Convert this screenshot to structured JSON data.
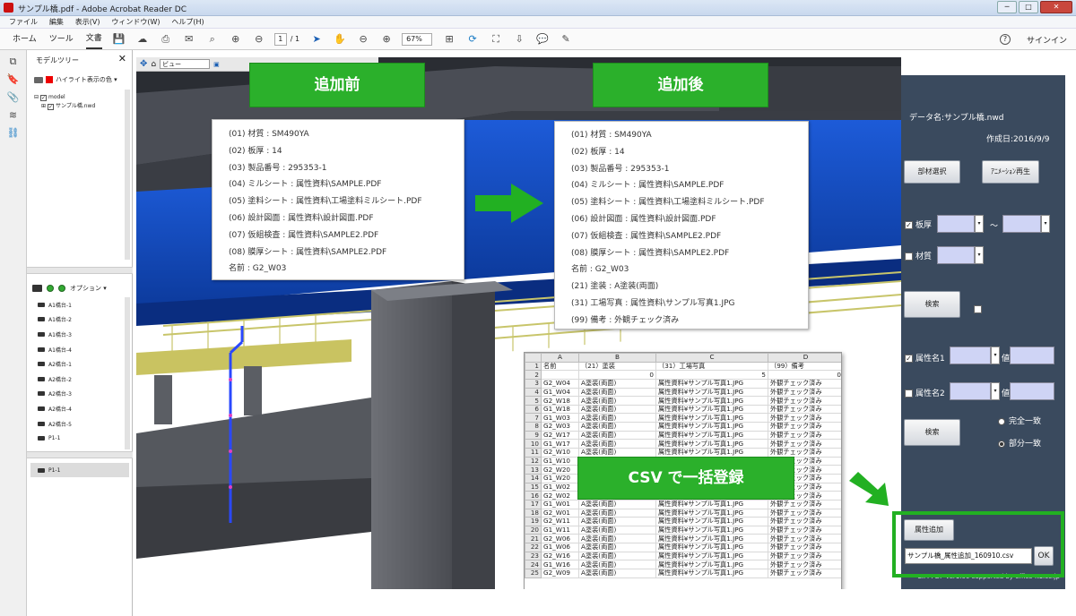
{
  "window": {
    "title": "サンプル橋.pdf - Adobe Acrobat Reader DC",
    "controls": [
      "─",
      "□",
      "✕"
    ]
  },
  "menu": [
    "ファイル",
    "編集",
    "表示(V)",
    "ウィンドウ(W)",
    "ヘルプ(H)"
  ],
  "toolbar": {
    "tabs": [
      "ホーム",
      "ツール",
      "文書"
    ],
    "active_tab": "文書",
    "page_current": "1",
    "page_total": "/ 1",
    "zoom": "67%",
    "help": "?",
    "signin": "サインイン"
  },
  "model_tree": {
    "title": "モデルツリー",
    "close": "✕",
    "highlight_label": "ハイライト表示の色 ▾",
    "highlight_color": "#e00000",
    "tree": [
      "model",
      "サンプル橋.nwd"
    ],
    "options_label": "オプション ▾",
    "items": [
      "A1橋台-1",
      "A1橋台-2",
      "A1橋台-3",
      "A1橋台-4",
      "A2橋台-1",
      "A2橋台-2",
      "A2橋台-3",
      "A2橋台-4",
      "A2橋台-5",
      "P1-1"
    ],
    "selected_item": "P1-1"
  },
  "viewer": {
    "view_select": "ビュー"
  },
  "labels": {
    "before": "追加前",
    "after": "追加後",
    "csv": "CSV で一括登録"
  },
  "before_props": [
    "(01) 材質 : SM490YA",
    "(02) 板厚 : 14",
    "(03) 製品番号 : 295353-1",
    "(04) ミルシート : 属性資料\\SAMPLE.PDF",
    "(05) 塗料シート : 属性資料\\工場塗料ミルシート.PDF",
    "(06) 設計図面 : 属性資料\\設計図面.PDF",
    "(07) 仮組検査 : 属性資料\\SAMPLE2.PDF",
    "(08) 膜厚シート : 属性資料\\SAMPLE2.PDF",
    "名前 : G2_W03"
  ],
  "after_props": [
    "(01) 材質 : SM490YA",
    "(02) 板厚 : 14",
    "(03) 製品番号 : 295353-1",
    "(04) ミルシート : 属性資料\\SAMPLE.PDF",
    "(05) 塗料シート : 属性資料\\工場塗料ミルシート.PDF",
    "(06) 設計図面 : 属性資料\\設計図面.PDF",
    "(07) 仮組検査 : 属性資料\\SAMPLE2.PDF",
    "(08) 膜厚シート : 属性資料\\SAMPLE2.PDF",
    "名前 : G2_W03",
    "(21) 塗装 : A塗装(両面)",
    "(31) 工場写真 : 属性資料\\サンプル写真1.JPG",
    "(99) 備考 : 外観チェック済み"
  ],
  "spreadsheet": {
    "col_letters": [
      "",
      "A",
      "B",
      "C",
      "D"
    ],
    "header_row": [
      "名前",
      "（21）塗装",
      "（31）工場写真",
      "（99）備考"
    ],
    "row2": [
      "",
      "0",
      "5",
      "0"
    ],
    "names": [
      "G2_W04",
      "G1_W04",
      "G2_W18",
      "G1_W18",
      "G1_W03",
      "G2_W03",
      "G2_W17",
      "G1_W17",
      "G2_W10",
      "G1_W10",
      "G2_W20",
      "G1_W20",
      "G1_W02",
      "G2_W02",
      "G1_W01",
      "G2_W01",
      "G2_W11",
      "G1_W11",
      "G2_W06",
      "G1_W06",
      "G2_W16",
      "G1_W16",
      "G2_W09"
    ],
    "paint": "A塗装(両面)",
    "photo": "属性資料¥サンプル写真1.JPG",
    "remark": "外観チェック済み"
  },
  "sidebar": {
    "data_name": "データ名:サンプル橋.nwd",
    "created": "作成日:2016/9/9",
    "select_button": "部材選択",
    "anim_button": "ｱﾆﾒｰｼｮﾝ再生",
    "thickness_label": "板厚",
    "tilde": "～",
    "material_label": "材質",
    "search1": "検索",
    "attr1": "属性名1",
    "attr2": "属性名2",
    "value": "値",
    "search2": "検索",
    "exact": "完全一致",
    "partial": "部分一致",
    "add_attr": "属性追加",
    "csv_file": "サンプル橋_属性追加_160910.csv",
    "ok": "OK",
    "footer": "CIM-PDF Ver1.00 supported by office-K1.co.jp"
  }
}
